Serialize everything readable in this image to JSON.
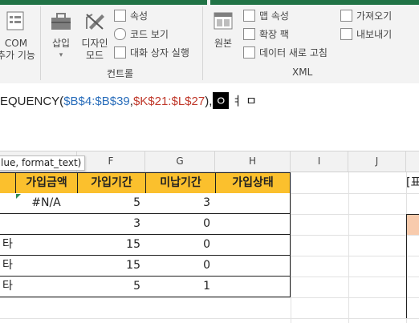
{
  "ribbon": {
    "com_label_1": "COM",
    "com_label_2": "추가 기능",
    "insert_label": "삽입",
    "design_mode_label_1": "디자인",
    "design_mode_label_2": "모드",
    "properties_label": "속성",
    "view_code_label": "코드 보기",
    "run_dialog_label": "대화 상자 실행",
    "controls_group_label": "컨트롤",
    "source_label": "원본",
    "map_properties_label": "맵 속성",
    "expansion_packs_label": "확장 팩",
    "refresh_data_label": "데이터 새로 고침",
    "import_label": "가져오기",
    "export_label": "내보내기",
    "xml_group_label": "XML"
  },
  "formula_bar": {
    "prefix": "EQUENCY(",
    "ref1": "$B$4:$B$39",
    "comma1": ",",
    "ref2": "$K$21:$L$27",
    "comma2": "),",
    "cursor_char": "ㅇ",
    "trailing": "ㅕ ㅁ"
  },
  "tooltip": {
    "text": "lue, format_text)"
  },
  "columns": [
    "F",
    "G",
    "H",
    "I",
    "J"
  ],
  "table": {
    "headers": [
      "가입금액",
      "가입기간",
      "미납기간",
      "가입상태"
    ],
    "rows": [
      {
        "left": "",
        "amount": "#N/A",
        "period": "5",
        "unpaid": "3",
        "status": ""
      },
      {
        "left": "",
        "amount": "",
        "period": "3",
        "unpaid": "0",
        "status": ""
      },
      {
        "left": "타",
        "amount": "",
        "period": "15",
        "unpaid": "0",
        "status": ""
      },
      {
        "left": "타",
        "amount": "",
        "period": "15",
        "unpaid": "0",
        "status": ""
      },
      {
        "left": "타",
        "amount": "",
        "period": "5",
        "unpaid": "1",
        "status": ""
      }
    ],
    "right_label": "[표"
  },
  "colors": {
    "header_fill": "#fbc02d",
    "ribbon_green": "#217346",
    "side_fill": "#f8cbad"
  }
}
